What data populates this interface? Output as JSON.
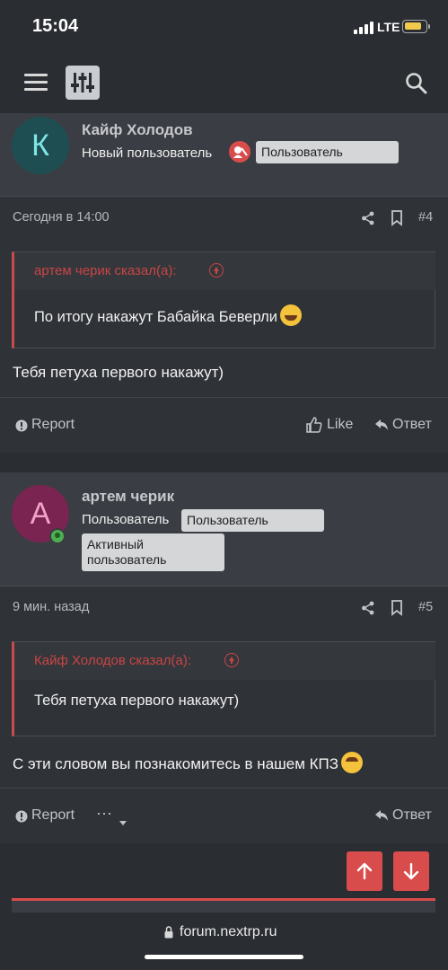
{
  "status_bar": {
    "time": "15:04",
    "network": "LTE",
    "battery_level": 0.8,
    "battery_color": "#f2c94c"
  },
  "nav": {
    "menu_icon": "hamburger-icon",
    "logo_icon": "sliders-logo-icon",
    "search_icon": "search-icon"
  },
  "posts": [
    {
      "avatar_letter": "К",
      "avatar_color": "#1f4e52",
      "avatar_text_color": "#7fe6e6",
      "username": "Кайф Холодов",
      "user_title": "Новый пользователь",
      "badges": [
        "Пользователь"
      ],
      "date": "Сегодня в 14:00",
      "number": "#4",
      "quote_author": "артем черик сказал(а):",
      "quote_text": "По итогу накажут Бабайка Беверли",
      "message": "Тебя петуха первого накажут)",
      "actions": {
        "report": "Report",
        "like": "Like",
        "reply": "Ответ"
      }
    },
    {
      "avatar_letter": "А",
      "avatar_color": "#7a2451",
      "avatar_text_color": "#f2a3c8",
      "username": "артем черик",
      "user_title": "Пользователь",
      "badges": [
        "Пользователь",
        "Активный пользователь"
      ],
      "date": "9 мин. назад",
      "number": "#5",
      "quote_author": "Кайф Холодов сказал(а):",
      "quote_text": "Тебя петуха первого накажут)",
      "message": "С эти словом вы познакомитесь в нашем КПЗ",
      "actions": {
        "report": "Report",
        "more": "···",
        "reply": "Ответ"
      }
    }
  ],
  "url_bar": {
    "domain": "forum.nextrp.ru"
  },
  "colors": {
    "accent": "#d94c4c",
    "background": "#2f3237",
    "panel": "#3a3d43"
  }
}
